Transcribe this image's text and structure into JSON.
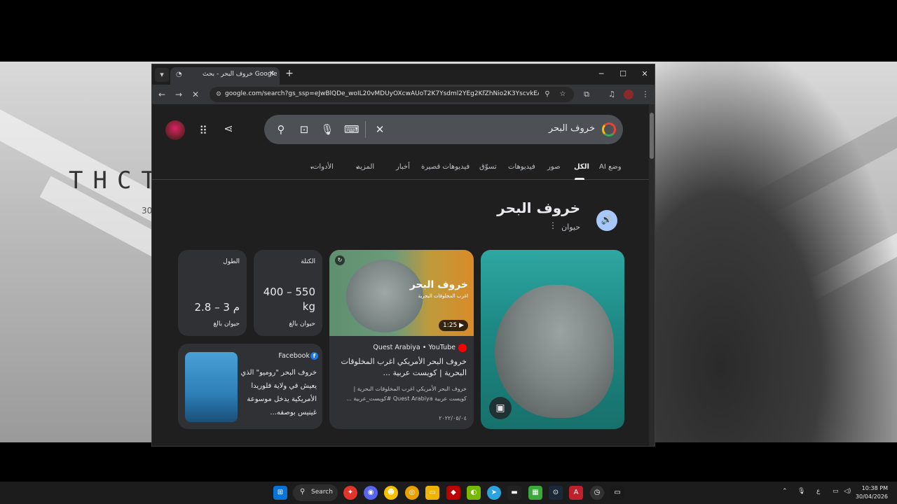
{
  "wallpaper": {
    "text": "THCT",
    "sub": "30"
  },
  "browser": {
    "tab": {
      "title": "خروف البحر - بحث Google"
    },
    "url": "google.com/search?gs_ssp=eJwBlQDe_woIL20vMDUyOXcwAUoT2K7Ysdml2YEg2KfZhNio2K3YscvkEAc&q=..."
  },
  "search": {
    "query": "خروف البحر",
    "tabs": [
      {
        "label": "وضع AI"
      },
      {
        "label": "الكل"
      },
      {
        "label": "صور"
      },
      {
        "label": "فيديوهات"
      },
      {
        "label": "تسوّق"
      },
      {
        "label": "فيديوهات قصيرة"
      },
      {
        "label": "أخبار"
      },
      {
        "label": "المزيد"
      },
      {
        "label": "الأدوات"
      }
    ]
  },
  "entity": {
    "title": "خروف البحر",
    "subtitle": "حيوان",
    "stats": [
      {
        "label": "الكتلة",
        "value": "400 – 550 kg",
        "note": "حيوان بالغ"
      },
      {
        "label": "الطول",
        "value": "2.8 – 3 م",
        "note": "حيوان بالغ"
      }
    ]
  },
  "video": {
    "thumb_title": "خروف البحر",
    "thumb_sub": "اغرب المخلوقات البحرية",
    "duration": "1:25",
    "source": "Quest Arabiya • YouTube",
    "title": "خروف البحر الأمريكي اغرب المخلوقات البحرية | كويست عربية ...",
    "snippet": "خروف البحر الأمريكي اغرب المخلوقات البحرية | كويست عربية Quest Arabiya #كويست_عربية ...",
    "date": "٢٠٢٢/٠٥/٠٤"
  },
  "facebook": {
    "source": "Facebook",
    "text": "خروف البحر \"روميو\" الذي يعيش في ولاية فلوريدا الأمريكية يدخل موسوعة غينيس بوصفه..."
  },
  "taskbar": {
    "search_label": "Search",
    "lang": "ع",
    "time": "10:38 PM",
    "date": "30/04/2026"
  },
  "colors": {
    "accent": "#a8c7fa",
    "background": "#1f1f1f",
    "card": "#303134"
  }
}
